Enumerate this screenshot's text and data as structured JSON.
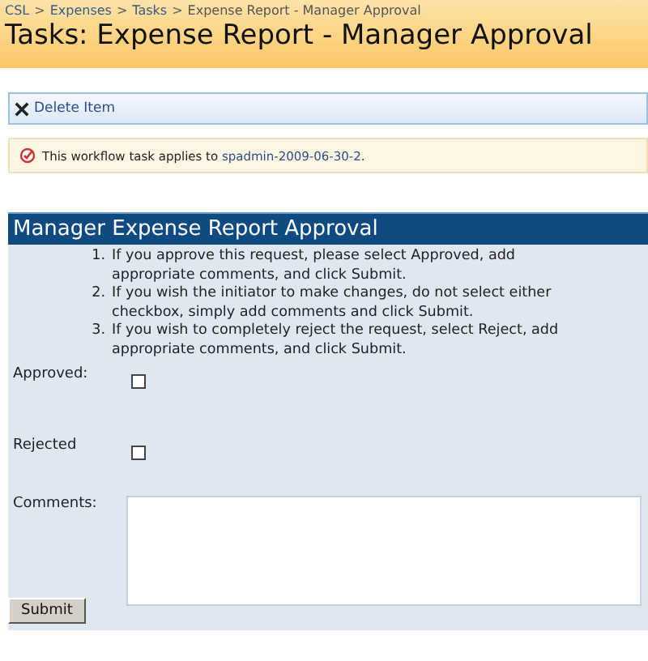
{
  "breadcrumb_separator": ">",
  "breadcrumb": [
    {
      "label": "CSL"
    },
    {
      "label": "Expenses"
    },
    {
      "label": "Tasks"
    },
    {
      "label": "Expense Report - Manager Approval"
    }
  ],
  "title": "Tasks: Expense Report - Manager Approval",
  "toolbar": {
    "label": "Delete Item"
  },
  "info": {
    "text": "This workflow task applies to ",
    "link": "spadmin-2009-06-30-2",
    "suffix": "."
  },
  "form": {
    "title": "Manager Expense Report Approval",
    "instructions": [
      {
        "number": "1.",
        "text": "If you approve this request, please select Approved, add appropriate comments, and click Submit."
      },
      {
        "number": "2.",
        "text": "If you wish the initiator to make changes, do not select either checkbox, simply add comments and click Submit."
      },
      {
        "number": "3.",
        "text": "If you wish to completely reject the request, select Reject, add appropriate comments, and click Submit."
      }
    ],
    "fields": [
      {
        "kind": "checkbox",
        "label": "Approved:",
        "checked": false
      },
      {
        "kind": "checkbox",
        "label": "Rejected",
        "checked": false
      },
      {
        "kind": "textarea",
        "label": "Comments:"
      }
    ],
    "submit": "Submit"
  }
}
